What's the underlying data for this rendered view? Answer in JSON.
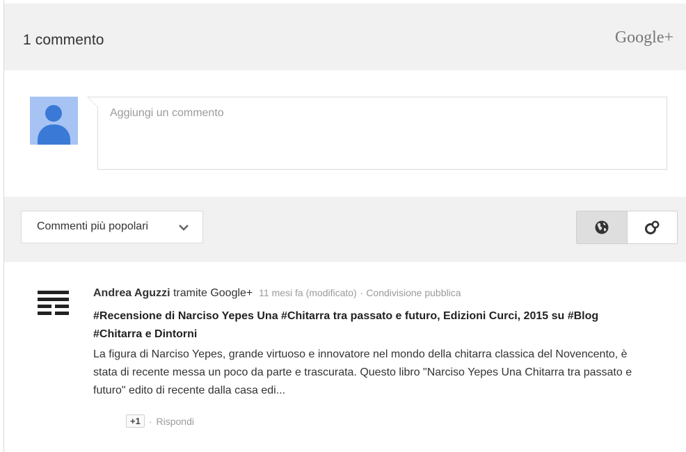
{
  "header": {
    "count": "1 commento",
    "brand": "Google+"
  },
  "compose": {
    "placeholder": "Aggiungi un commento"
  },
  "sort": {
    "label": "Commenti più popolari",
    "icons": [
      "globe-icon",
      "circles-icon"
    ]
  },
  "comment": {
    "author": "Andrea Aguzzi",
    "via": "tramite Google+",
    "time": "11 mesi fa (modificato)",
    "separator": "·",
    "share": "Condivisione pubblica",
    "title": "#Recensione di Narciso Yepes Una #Chitarra tra passato e futuro, Edizioni Curci, 2015 su #Blog #Chitarra e Dintorni",
    "body": "La figura di Narciso Yepes, grande virtuoso e innovatore nel mondo della chitarra classica del Novencento, è stata di recente messa un poco da parte e trascurata. Questo libro \"Narciso Yepes Una Chitarra tra passato e futuro\" edito di recente dalla casa edi...",
    "plusone": "+1",
    "action_separator": "·",
    "reply": "Rispondi"
  },
  "colors": {
    "panel": "#f1f1f1",
    "avatar_bg": "#a6c3f3",
    "avatar_fg": "#3b79d6",
    "muted_text": "#9a9a9a"
  }
}
